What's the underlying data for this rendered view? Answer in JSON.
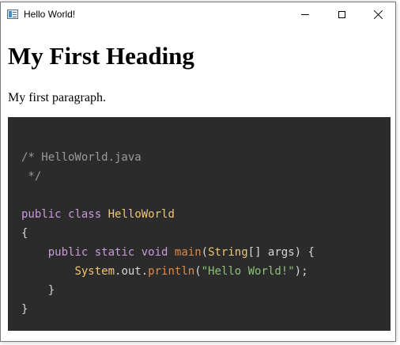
{
  "window": {
    "title": "Hello World!",
    "icon": "app-window-icon",
    "controls": {
      "minimize": "minimize-icon",
      "maximize": "maximize-icon",
      "close": "close-icon"
    }
  },
  "page": {
    "heading": "My First Heading",
    "paragraph": "My first paragraph."
  },
  "code": {
    "background": "#2b2b2b",
    "line1": "/* HelloWorld.java",
    "line2": " */",
    "kw_public": "public",
    "kw_class": "class",
    "class_name": "HelloWorld",
    "open_brace": "{",
    "kw_static": "static",
    "kw_void": "void",
    "method_name": "main",
    "param_type": "String",
    "param_rest": "[] args) {",
    "sys": "System",
    "dot_out": ".out.",
    "println": "println",
    "str_literal": "\"Hello World!\"",
    "end_stmt": ");",
    "inner_close": "}",
    "outer_close": "}"
  }
}
